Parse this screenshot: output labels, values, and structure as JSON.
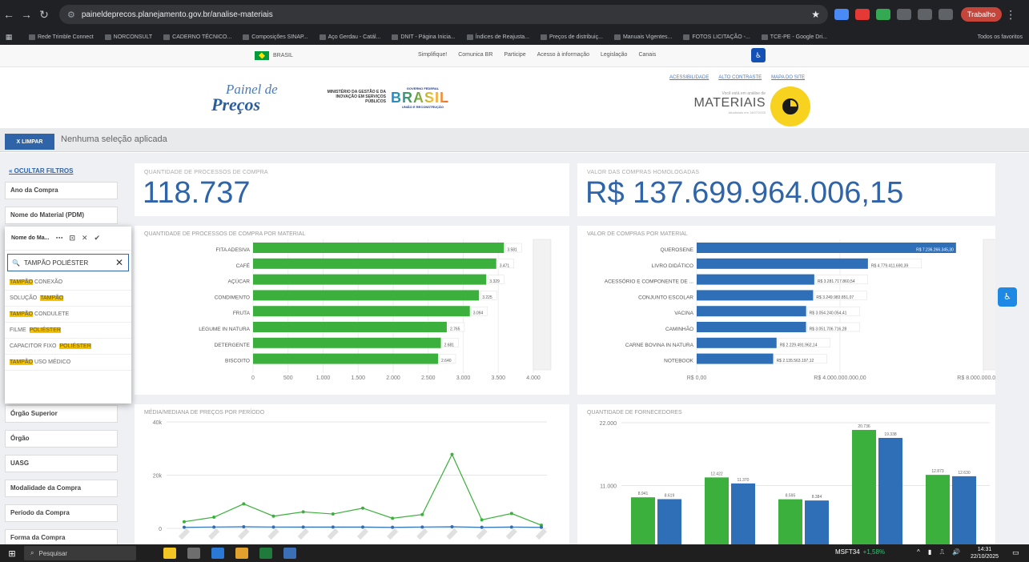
{
  "browser": {
    "url": "paineldeprecos.planejamento.gov.br/analise-materiais",
    "profile": "Trabalho",
    "bookmarks": [
      "Rede Trimble Connect",
      "NORCONSULT",
      "CADERNO TÉCNICO...",
      "Composições SINAP...",
      "Aço Gerdau - Catál...",
      "DNIT - Página Inicia...",
      "Índices de Reajusta...",
      "Preços de distribuiç...",
      "Manuais Vigentes...",
      "FOTOS LICITAÇÃO -...",
      "TCE-PE - Google Dri..."
    ],
    "all_bookmarks": "Todos os favoritos"
  },
  "govbar": {
    "country": "BRASIL",
    "links": [
      "Simplifique!",
      "Comunica BR",
      "Participe",
      "Acesso à informação",
      "Legislação",
      "Canais"
    ]
  },
  "header": {
    "logo_line1": "Painel de",
    "logo_line2": "Preços",
    "ministry": "MINISTÉRIO DA GESTÃO E DA INOVAÇÃO EM SERVIÇOS PÚBLICOS",
    "gov_top": "GOVERNO FEDERAL",
    "gov_brand": "BRASIL",
    "gov_bottom": "UNIÃO E RECONSTRUÇÃO",
    "top_links": [
      "ACESSIBILIDADE",
      "ALTO CONTRASTE",
      "MAPA DO SITE"
    ],
    "module_sub": "Você está em análise de",
    "module_title": "MATERIAIS",
    "module_updated": "Atualizado em 14/07/2025"
  },
  "filterbar": {
    "clear_label": "X LIMPAR",
    "no_selection": "Nenhuma seleção aplicada"
  },
  "sidebar": {
    "hide_filters": "« OCULTAR FILTROS",
    "fields": [
      {
        "label": "Ano da Compra"
      },
      {
        "label": "Nome do Material (PDM)"
      },
      {
        "label": "Órgão Superior"
      },
      {
        "label": "Órgão"
      },
      {
        "label": "UASG"
      },
      {
        "label": "Modalidade da Compra"
      },
      {
        "label": "Período da Compra"
      },
      {
        "label": "Forma da Compra"
      }
    ],
    "dropdown": {
      "title": "Nome do Ma...",
      "search_value": "TAMPÃO POLIÉSTER",
      "items": [
        [
          {
            "t": "TAMPÃO",
            "h": true
          },
          {
            "t": "CONEXÃO",
            "h": false
          }
        ],
        [
          {
            "t": "SOLUÇÃO",
            "h": false
          },
          {
            "t": "TAMPÃO",
            "h": true
          }
        ],
        [
          {
            "t": "TAMPÃO",
            "h": true
          },
          {
            "t": "CONDULETE",
            "h": false
          }
        ],
        [
          {
            "t": "FILME",
            "h": false
          },
          {
            "t": "POLIÉSTER",
            "h": true
          }
        ],
        [
          {
            "t": "CAPACITOR FIXO",
            "h": false
          },
          {
            "t": "POLIÉSTER",
            "h": true
          }
        ],
        [
          {
            "t": "TAMPÃO",
            "h": true
          },
          {
            "t": "USO MÉDICO",
            "h": false
          }
        ]
      ]
    }
  },
  "kpis": {
    "processes_label": "QUANTIDADE DE PROCESSOS DE COMPRA",
    "processes_value": "118.737",
    "value_label": "VALOR DAS COMPRAS HOMOLOGADAS",
    "value_value": "R$ 137.699.964.006,15"
  },
  "colors": {
    "green": "#3cb03c",
    "blue": "#2f6fb8",
    "accent": "#2f64a8"
  },
  "chart_data": [
    {
      "id": "qty",
      "type": "bar",
      "orientation": "horizontal",
      "title": "QUANTIDADE DE PROCESSOS DE COMPRA POR MATERIAL",
      "categories": [
        "FITA ADESIVA",
        "CAFÉ",
        "AÇÚCAR",
        "CONDIMENTO",
        "FRUTA",
        "LEGUME IN NATURA",
        "DETERGENTE",
        "BISCOITO"
      ],
      "values": [
        3581,
        3471,
        3329,
        3225,
        3094,
        2765,
        2681,
        2640
      ],
      "labels": [
        "3.581",
        "3.471",
        "3.329",
        "3.225",
        "3.094",
        "2.765",
        "2.681",
        "2.640"
      ],
      "xlim": [
        0,
        4000
      ],
      "ticks": [
        0,
        500,
        1000,
        1500,
        2000,
        2500,
        3000,
        3500,
        4000
      ],
      "tick_labels": [
        "0",
        "500",
        "1.000",
        "1.500",
        "2.000",
        "2.500",
        "3.000",
        "3.500",
        "4.000"
      ]
    },
    {
      "id": "val",
      "type": "bar",
      "orientation": "horizontal",
      "title": "VALOR DE COMPRAS POR MATERIAL",
      "categories": [
        "QUEROSENE",
        "LIVRO DIDÁTICO",
        "ACESSÓRIO E COMPONENTE DE ...",
        "CONJUNTO ESCOLAR",
        "VACINA",
        "CAMINHÃO",
        "CARNE BOVINA IN NATURA",
        "NOTEBOOK"
      ],
      "values": [
        7236266345.3,
        4779411690.39,
        3281717860.54,
        3249983851.07,
        3054240054.41,
        3051706716.28,
        2229491962.14,
        2135563197.12
      ],
      "labels": [
        "R$ 7.236.266.345,30",
        "R$ 4.779.411.690,39",
        "R$ 3.281.717.860,54",
        "R$ 3.249.983.851,07",
        "R$ 3.054.240.054,41",
        "R$ 3.051.706.716,28",
        "R$ 2.229.491.962,14",
        "R$ 2.135.563.197,12"
      ],
      "xlim": [
        0,
        8000000000
      ],
      "ticks": [
        0,
        4000000000,
        8000000000
      ],
      "tick_labels": [
        "R$ 0,00",
        "R$ 4.000.000.000,00",
        "R$ 8.000.000.000,00"
      ]
    },
    {
      "id": "median",
      "type": "line",
      "title": "MÉDIA/MEDIANA DE PREÇOS POR PERÍODO",
      "x": [
        1,
        2,
        3,
        4,
        5,
        6,
        7,
        8,
        9,
        10,
        11,
        12,
        13
      ],
      "series": [
        {
          "values": [
            2500,
            4200,
            9200,
            4600,
            6200,
            5400,
            7600,
            3800,
            5200,
            27800,
            3200,
            5600,
            1200
          ]
        },
        {
          "values": [
            400,
            500,
            600,
            500,
            500,
            500,
            500,
            400,
            500,
            600,
            400,
            500,
            400
          ]
        }
      ],
      "ylim": [
        0,
        40000
      ],
      "ticks": [
        0,
        20000,
        40000
      ],
      "tick_labels": [
        "0",
        "20k",
        "40k"
      ]
    },
    {
      "id": "suppliers",
      "type": "bar",
      "title": "QUANTIDADE DE FORNECEDORES",
      "series": [
        {
          "values": [
            8941,
            12422,
            8595,
            20736,
            12873
          ],
          "labels": [
            "8.941",
            "12.422",
            "8.595",
            "20.736",
            "12.873"
          ]
        },
        {
          "values": [
            8619,
            11370,
            8384,
            19338,
            12630
          ],
          "labels": [
            "8.619",
            "11.370",
            "8.384",
            "19.338",
            "12.630"
          ]
        }
      ],
      "ylim": [
        0,
        22000
      ],
      "ticks": [
        0,
        11000,
        22000
      ],
      "tick_labels": [
        "0",
        "11.000",
        "22.000"
      ]
    }
  ],
  "taskbar": {
    "search": "Pesquisar",
    "stock_symbol": "MSFT34",
    "stock_change": "+1,58%",
    "time": "14:31",
    "date": "22/10/2025"
  }
}
